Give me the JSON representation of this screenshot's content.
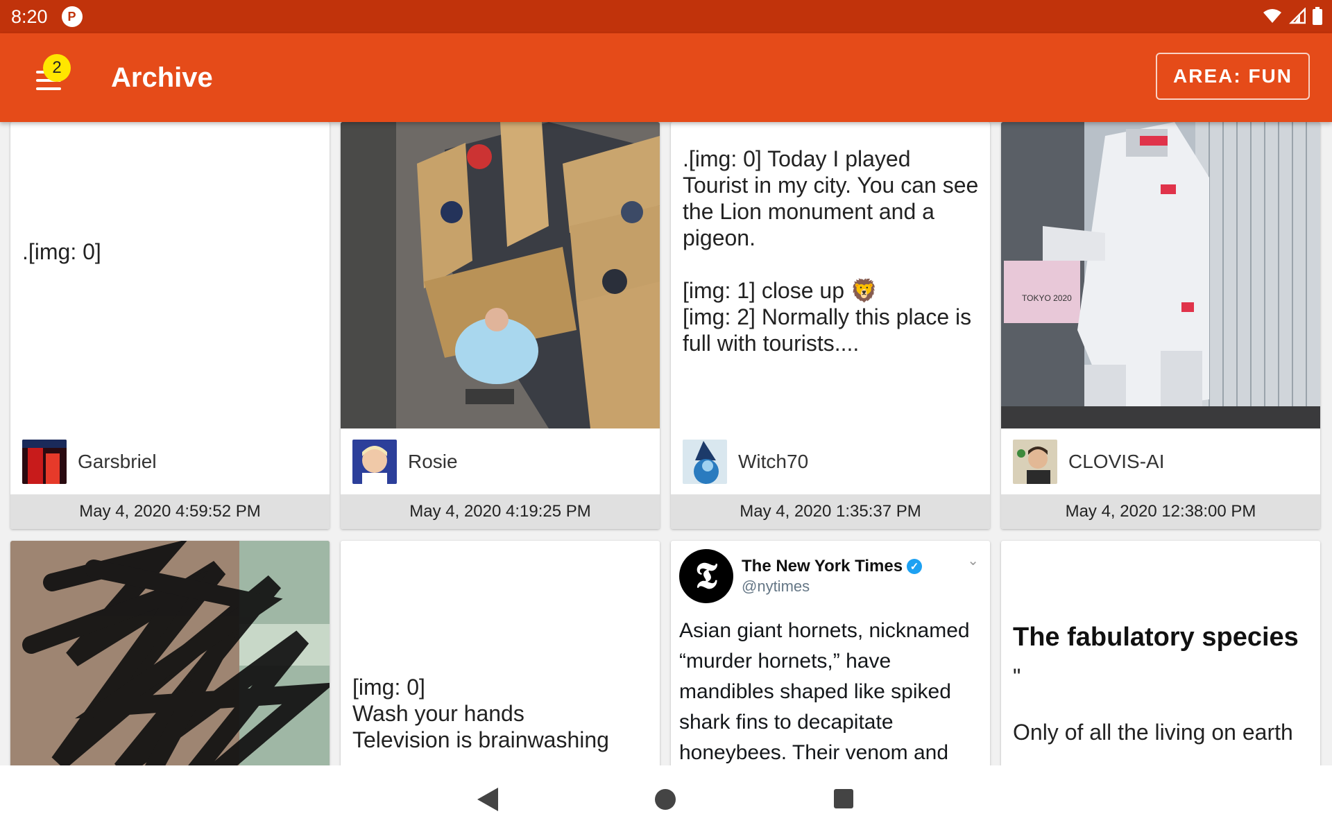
{
  "status_bar": {
    "time": "8:20",
    "notification_icon": "app-notification-icon"
  },
  "app_bar": {
    "badge_count": "2",
    "title": "Archive",
    "area_button_label": "AREA: FUN",
    "accent_color": "#e54b19",
    "status_color": "#c1330b"
  },
  "cards": [
    {
      "text": ".[img: 0]",
      "author": "Garsbriel",
      "date": "May 4, 2020 4:59:52 PM"
    },
    {
      "author": "Rosie",
      "date": "May 4, 2020 4:19:25 PM"
    },
    {
      "text": ".[img: 0] Today I played Tourist in my city. You can see the Lion monument and a pigeon.\n\n[img: 1] close up 🦁\n[img: 2] Normally this place is full with tourists....",
      "author": "Witch70",
      "date": "May 4, 2020 1:35:37 PM"
    },
    {
      "author": "CLOVIS-AI",
      "date": "May 4, 2020 12:38:00 PM"
    },
    {},
    {
      "text": "[img: 0]\nWash your hands\nTelevision is brainwashing"
    },
    {
      "tweet": {
        "name": "The New York Times",
        "handle": "@nytimes",
        "text": "Asian giant hornets, nicknamed “murder hornets,” have mandibles shaped like spiked shark fins to decapitate honeybees. Their venom and"
      }
    },
    {
      "title": "The fabulatory species",
      "body": "\"\n\nOnly of all the living on earth"
    }
  ]
}
